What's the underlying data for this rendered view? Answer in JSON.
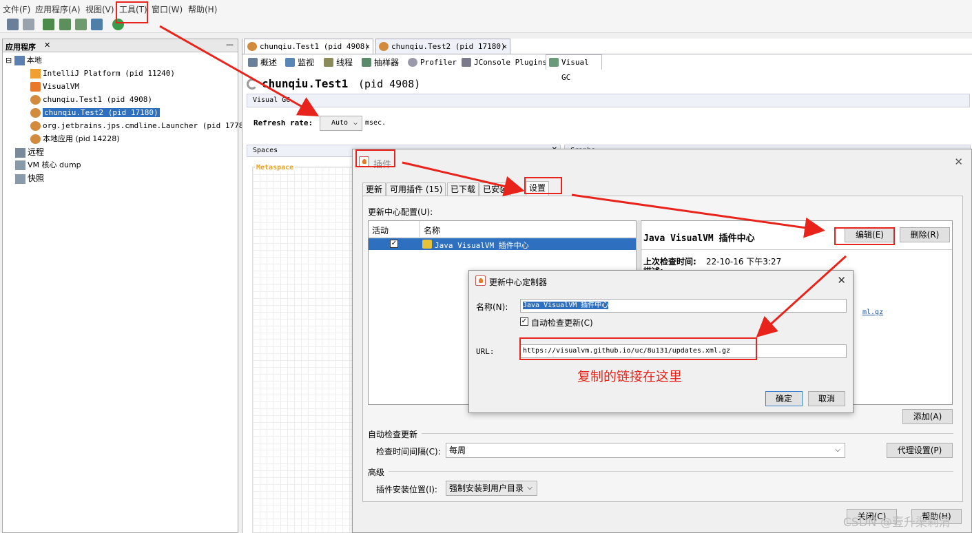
{
  "menubar": {
    "items": [
      "文件(F)",
      "应用程序(A)",
      "视图(V)",
      "工具(T)",
      "窗口(W)",
      "帮助(H)"
    ]
  },
  "left_panel": {
    "title": "应用程序",
    "close_glyph": "✕",
    "min_glyph": "—",
    "tree": [
      {
        "label": "本地",
        "icon": "computer-icon"
      },
      {
        "label": "IntelliJ Platform (pid 11240)",
        "icon": "intellij-icon"
      },
      {
        "label": "VisualVM",
        "icon": "visualvm-icon"
      },
      {
        "label": "chunqiu.Test1 (pid 4908)",
        "icon": "java-icon"
      },
      {
        "label": "chunqiu.Test2 (pid 17180)",
        "icon": "java-icon",
        "selected": true
      },
      {
        "label": "org.jetbrains.jps.cmdline.Launcher (pid 17788)",
        "icon": "java-icon"
      },
      {
        "label": "本地应用 (pid 14228)",
        "icon": "java-icon"
      },
      {
        "label": "远程",
        "icon": "network-icon"
      },
      {
        "label": "VM 核心 dump",
        "icon": "dump-icon"
      },
      {
        "label": "快照",
        "icon": "snapshot-icon"
      }
    ]
  },
  "main": {
    "doc_tabs": [
      {
        "label": "chunqiu.Test1 (pid 4908)"
      },
      {
        "label": "chunqiu.Test2 (pid 17180)"
      }
    ],
    "tab_close": "✕",
    "sub_tabs": [
      "概述",
      "监视",
      "线程",
      "抽样器",
      "Profiler",
      "JConsole Plugins",
      "Visual GC"
    ],
    "title": "chunqiu.Test1",
    "title_pid": "(pid 4908)",
    "visual_gc_label": "Visual GC",
    "refresh_label": "Refresh rate:",
    "refresh_value": "Auto",
    "refresh_unit": "msec.",
    "spaces_label": "Spaces",
    "graphs_label": "Graphs",
    "metaspace_label": "Metaspace"
  },
  "plugins_dialog": {
    "title": "插件",
    "close_glyph": "✕",
    "tabs": [
      "更新",
      "可用插件 (15)",
      "已下载",
      "已安装",
      "设置"
    ],
    "center_config_label": "更新中心配置(U):",
    "table_headers": [
      "活动",
      "名称"
    ],
    "table_rows": [
      {
        "active": true,
        "name": "Java VisualVM 插件中心"
      }
    ],
    "detail_title": "Java VisualVM 插件中心",
    "edit_button": "编辑(E)",
    "delete_button": "删除(R)",
    "last_check_label": "上次检查时间:",
    "last_check_value": "22-10-16 下午3:27",
    "desc_label": "描述:",
    "url_tail": "ml.gz",
    "add_button": "添加(A)",
    "auto_check_section": "自动检查更新",
    "interval_label": "检查时间间隔(C):",
    "interval_value": "每周",
    "proxy_button": "代理设置(P)",
    "advanced_section": "高级",
    "install_location_label": "插件安装位置(I):",
    "install_location_value": "强制安装到用户目录",
    "close_button": "关闭(C)",
    "help_button": "帮助(H)"
  },
  "custom_dialog": {
    "title": "更新中心定制器",
    "close_glyph": "✕",
    "name_label": "名称(N):",
    "name_value": "Java VisualVM 插件中心",
    "auto_check_label": "自动检查更新(C)",
    "auto_check_checked": true,
    "url_label": "URL:",
    "url_value": "https://visualvm.github.io/uc/8u131/updates.xml.gz",
    "ok_button": "确定",
    "cancel_button": "取消"
  },
  "annotation": {
    "text": "复制的链接在这里",
    "color": "#e8231b"
  },
  "watermark": "CSDN @壹升渠莉清"
}
